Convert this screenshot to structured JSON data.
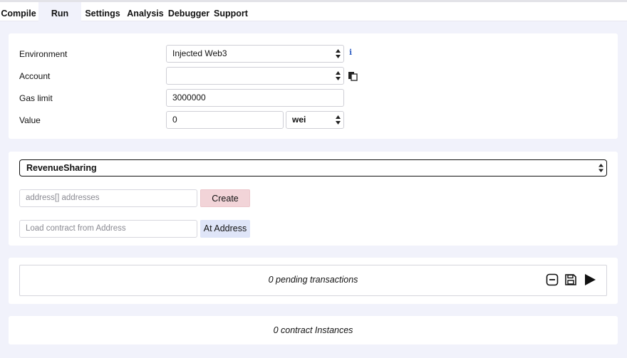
{
  "tabs": [
    {
      "label": "Compile"
    },
    {
      "label": "Run"
    },
    {
      "label": "Settings"
    },
    {
      "label": "Analysis"
    },
    {
      "label": "Debugger"
    },
    {
      "label": "Support"
    }
  ],
  "active_tab": "Run",
  "settings": {
    "environment_label": "Environment",
    "environment_value": "Injected Web3",
    "info_glyph": "i",
    "account_label": "Account",
    "account_value": "",
    "gas_label": "Gas limit",
    "gas_value": "3000000",
    "value_label": "Value",
    "value_amount": "0",
    "value_unit": "wei"
  },
  "contract": {
    "selected": "RevenueSharing",
    "constructor_placeholder": "address[] addresses",
    "create_label": "Create",
    "address_placeholder": "Load contract from Address",
    "at_address_label": "At Address"
  },
  "transactions": {
    "pending_text": "0 pending transactions"
  },
  "instances": {
    "text": "0 contract Instances"
  },
  "icons": {
    "info": "info-icon",
    "copy": "copy-icon",
    "clear": "minus-square-icon",
    "save": "save-icon",
    "play": "play-icon"
  },
  "colors": {
    "background": "#f1f2fb",
    "create_button": "#f2d4d8",
    "at_address_button": "#dfe5f8",
    "info": "#3a66c6"
  }
}
